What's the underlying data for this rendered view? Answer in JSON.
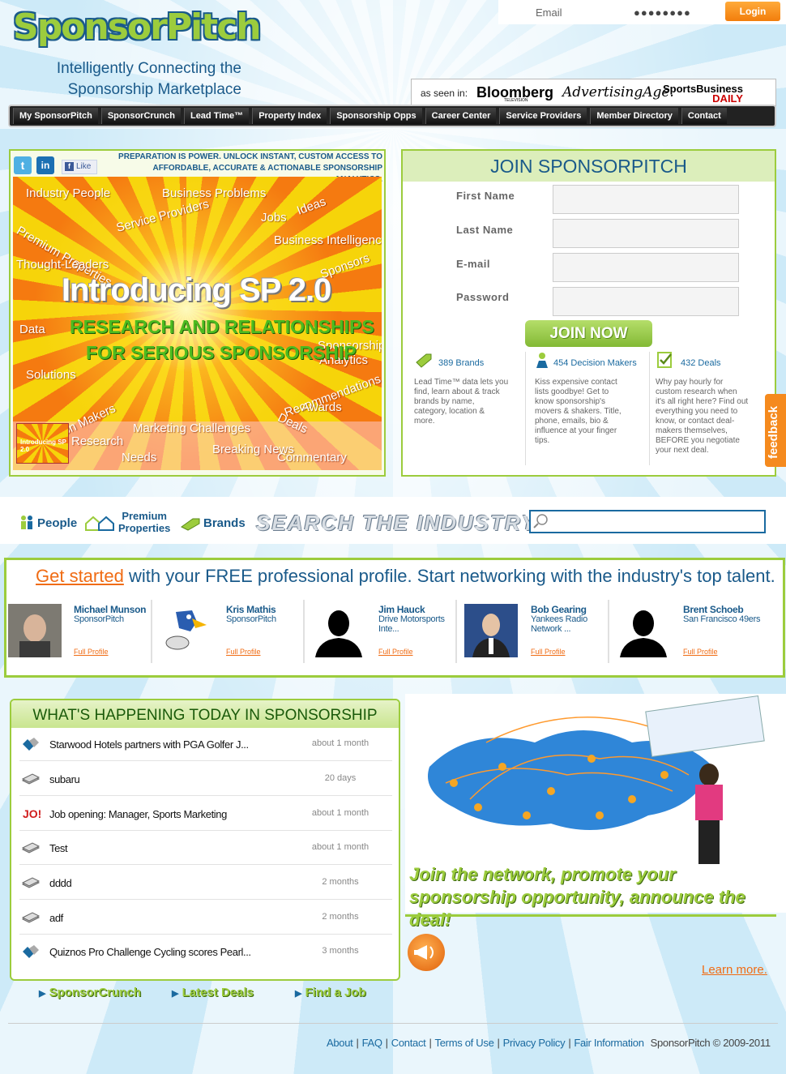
{
  "header": {
    "logo": "SponsorPitch",
    "tagline_line1": "Intelligently Connecting the",
    "tagline_line2": "Sponsorship Marketplace",
    "login": {
      "email_placeholder": "Email",
      "password_value": "●●●●●●●●",
      "login_label": "Login"
    },
    "as_seen_in": {
      "label": "as seen in:",
      "bloomberg": "Bloomberg",
      "bloomberg_sub": "TELEVISION",
      "adage": "AdvertisingAge.",
      "sbd_line1": "SportsBusiness",
      "sbd_line2": "DAILY"
    }
  },
  "nav": [
    "My SponsorPitch",
    "SponsorCrunch",
    "Lead Time™",
    "Property Index",
    "Sponsorship Opps",
    "Career Center",
    "Service Providers",
    "Member Directory",
    "Contact"
  ],
  "promo_banner": {
    "social": {
      "twitter": "t",
      "linkedin": "in",
      "like": "Like"
    },
    "headline_line1": "Preparation is power. Unlock instant, custom access to",
    "headline_line2": "affordable, accurate & actionable sponsorship analytics.",
    "title": "Introducing SP 2.0",
    "subtitle_line1": "RESEARCH AND RELATIONSHIPS",
    "subtitle_line2": "FOR SERIOUS SPONSORSHIP",
    "words": [
      "Industry People",
      "Business Problems",
      "Ideas",
      "Service Providers",
      "Jobs",
      "Premium Properties",
      "Business Intelligence",
      "Thought-Leaders",
      "Sponsors",
      "Data",
      "Sponsorship",
      "Analytics",
      "Solutions",
      "Recommendations",
      "Awards",
      "Decision Makers",
      "Deals",
      "Marketing Challenges",
      "Research",
      "Breaking News",
      "Needs",
      "Commentary"
    ],
    "thumb_text": "Introducing SP 2.0"
  },
  "join": {
    "heading": "JOIN SPONSORPITCH",
    "fields": {
      "first_name": "First Name",
      "last_name": "Last Name",
      "email": "E-mail",
      "password": "Password"
    },
    "button": "JOIN NOW",
    "features": [
      {
        "icon": "tag-icon",
        "count": "389 Brands",
        "desc": [
          "Lead Time™ data lets you",
          "find, learn about & track",
          "brands by name,",
          "category, location &",
          "more."
        ]
      },
      {
        "icon": "person-icon",
        "count": "454 Decision Makers",
        "desc": [
          "Kiss expensive contact",
          "lists goodbye! Get to",
          "know sponsorship's",
          "movers & shakers. Title,",
          "phone, emails, bio &",
          "influence at your finger",
          "tips."
        ]
      },
      {
        "icon": "check-icon",
        "count": "432 Deals",
        "desc": [
          "Why pay hourly for",
          "custom research when",
          "it's all right here? Find out",
          "everything you need to",
          "know, or contact deal-",
          "makers themselves,",
          "BEFORE you negotiate",
          "your next deal."
        ]
      }
    ]
  },
  "feedback": "feedback",
  "search": {
    "people": "People",
    "premium_line1": "Premium",
    "premium_line2": "Properties",
    "brands": "Brands",
    "title": "SEARCH THE INDUSTRY",
    "input_value": ""
  },
  "get_started": {
    "accent": "Get started",
    "rest": " with your FREE professional profile. Start networking with the industry's top talent.",
    "people": [
      {
        "name": "Michael Munson",
        "sub1": "SponsorPitch",
        "sub2": "",
        "link": "Full Profile",
        "photo": "photo"
      },
      {
        "name": "Kris Mathis",
        "sub1": "SponsorPitch",
        "sub2": "",
        "link": "Full Profile",
        "photo": "bird"
      },
      {
        "name": "Jim Hauck",
        "sub1": "Drive Motorsports",
        "sub2": "Inte...",
        "link": "Full Profile",
        "photo": "silhouette"
      },
      {
        "name": "Bob Gearing",
        "sub1": "Yankees Radio",
        "sub2": "Network ...",
        "link": "Full Profile",
        "photo": "photo2"
      },
      {
        "name": "Brent Schoeb",
        "sub1": "San Francisco 49ers",
        "sub2": "",
        "link": "Full Profile",
        "photo": "silhouette"
      }
    ]
  },
  "happening": {
    "heading": "WHAT'S HAPPENING TODAY IN SPONSORSHIP",
    "items": [
      {
        "icon": "handshake-icon",
        "title": "Starwood Hotels partners with PGA Golfer J...",
        "time": "about 1 month"
      },
      {
        "icon": "money-icon",
        "title": "subaru",
        "time": "20 days"
      },
      {
        "icon": "job-icon",
        "title": "Job opening: Manager, Sports Marketing",
        "time": "about 1 month"
      },
      {
        "icon": "money-icon",
        "title": "Test",
        "time": "about 1 month"
      },
      {
        "icon": "money-icon",
        "title": "dddd",
        "time": "2 months"
      },
      {
        "icon": "money-icon",
        "title": "adf",
        "time": "2 months"
      },
      {
        "icon": "handshake-icon",
        "title": "Quiznos Pro Challenge Cycling scores Pearl...",
        "time": "3 months"
      }
    ],
    "links": [
      "SponsorCrunch",
      "Latest Deals",
      "Find a Job"
    ]
  },
  "promo": {
    "line1": "Join the network, promote your",
    "line2": "sponsorship opportunity, announce the deal!",
    "learn_more": "Learn more."
  },
  "footer": {
    "links": [
      "About",
      "FAQ",
      "Contact",
      "Terms of Use",
      "Privacy Policy",
      "Fair Information"
    ],
    "copyright": "SponsorPitch © 2009-2011"
  },
  "colors": {
    "brand_green": "#9ccc3d",
    "brand_blue": "#1a5a8a",
    "accent_orange": "#f06c14"
  }
}
